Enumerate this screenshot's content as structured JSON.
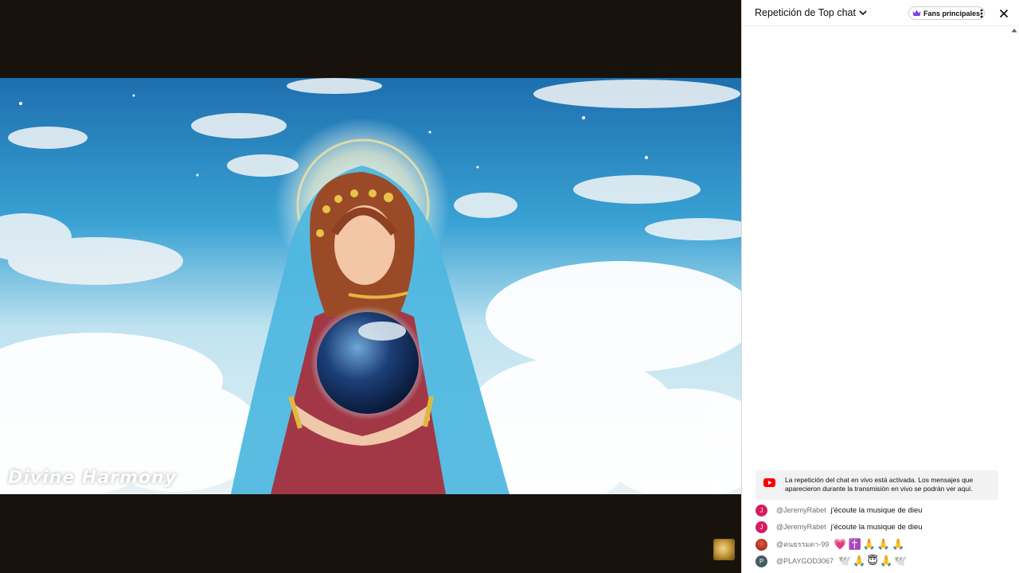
{
  "video": {
    "watermark": "Divine Harmony"
  },
  "chat": {
    "title": "Repetición de Top chat",
    "fans_button_label": "Fans principales",
    "notice": "La repetición del chat en vivo está activada. Los mensajes que aparecieron durante la transmisión en vivo se podrán ver aquí.",
    "messages": [
      {
        "avatar_letter": "J",
        "avatar_color": "#d81b60",
        "author": "@JeremyRabet",
        "text": "j'écoute la musique de dieu"
      },
      {
        "avatar_letter": "J",
        "avatar_color": "#d81b60",
        "author": "@JeremyRabet",
        "text": "j'écoute la musique de dieu"
      },
      {
        "avatar_letter": "",
        "avatar_color": "#b5352b",
        "author": "@คนธรรมดา-99",
        "text": "💗✝️🙏🙏🙏"
      },
      {
        "avatar_letter": "P",
        "avatar_color": "#455a64",
        "author": "@PLAYGOD3067",
        "text": "🕊️🙏😇🙏🕊️"
      }
    ]
  },
  "colors": {
    "youtube_red": "#ff0000",
    "crown_purple": "#7b3fe4"
  }
}
